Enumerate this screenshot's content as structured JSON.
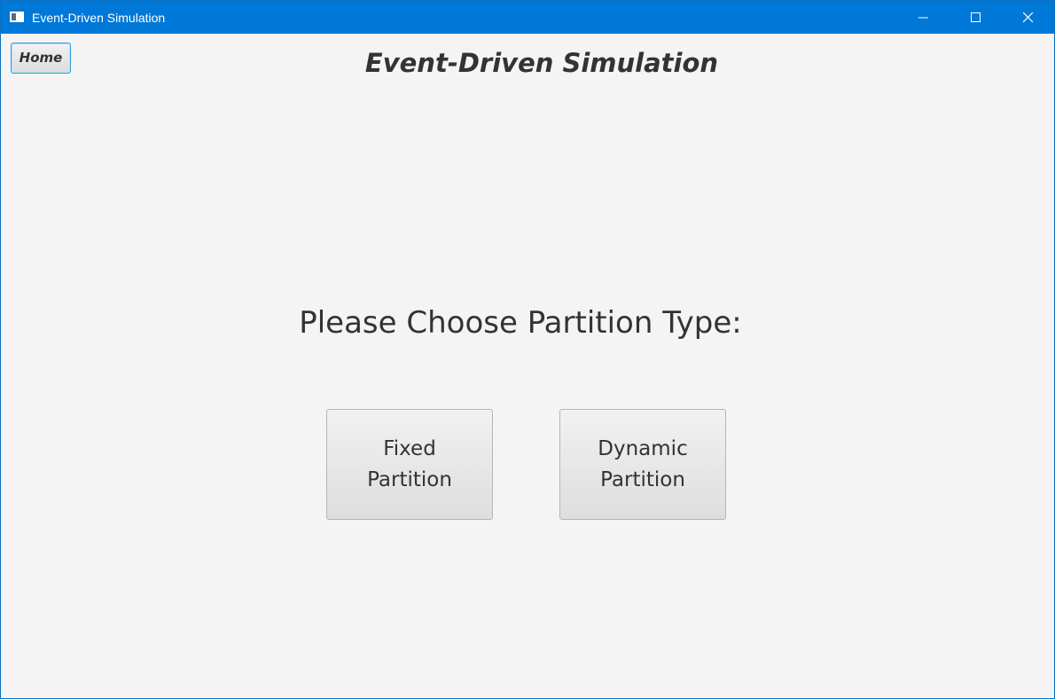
{
  "window": {
    "title": "Event-Driven Simulation",
    "controls": {
      "minimize_icon": "minimize-icon",
      "maximize_icon": "maximize-icon",
      "close_icon": "close-icon"
    },
    "titlebar_color": "#0078d7"
  },
  "toolbar": {
    "home_label": "Home"
  },
  "header": {
    "title": "Event-Driven Simulation"
  },
  "main": {
    "prompt": "Please Choose Partition Type:",
    "options": [
      {
        "line1": "Fixed",
        "line2": "Partition"
      },
      {
        "line1": "Dynamic",
        "line2": "Partition"
      }
    ]
  }
}
